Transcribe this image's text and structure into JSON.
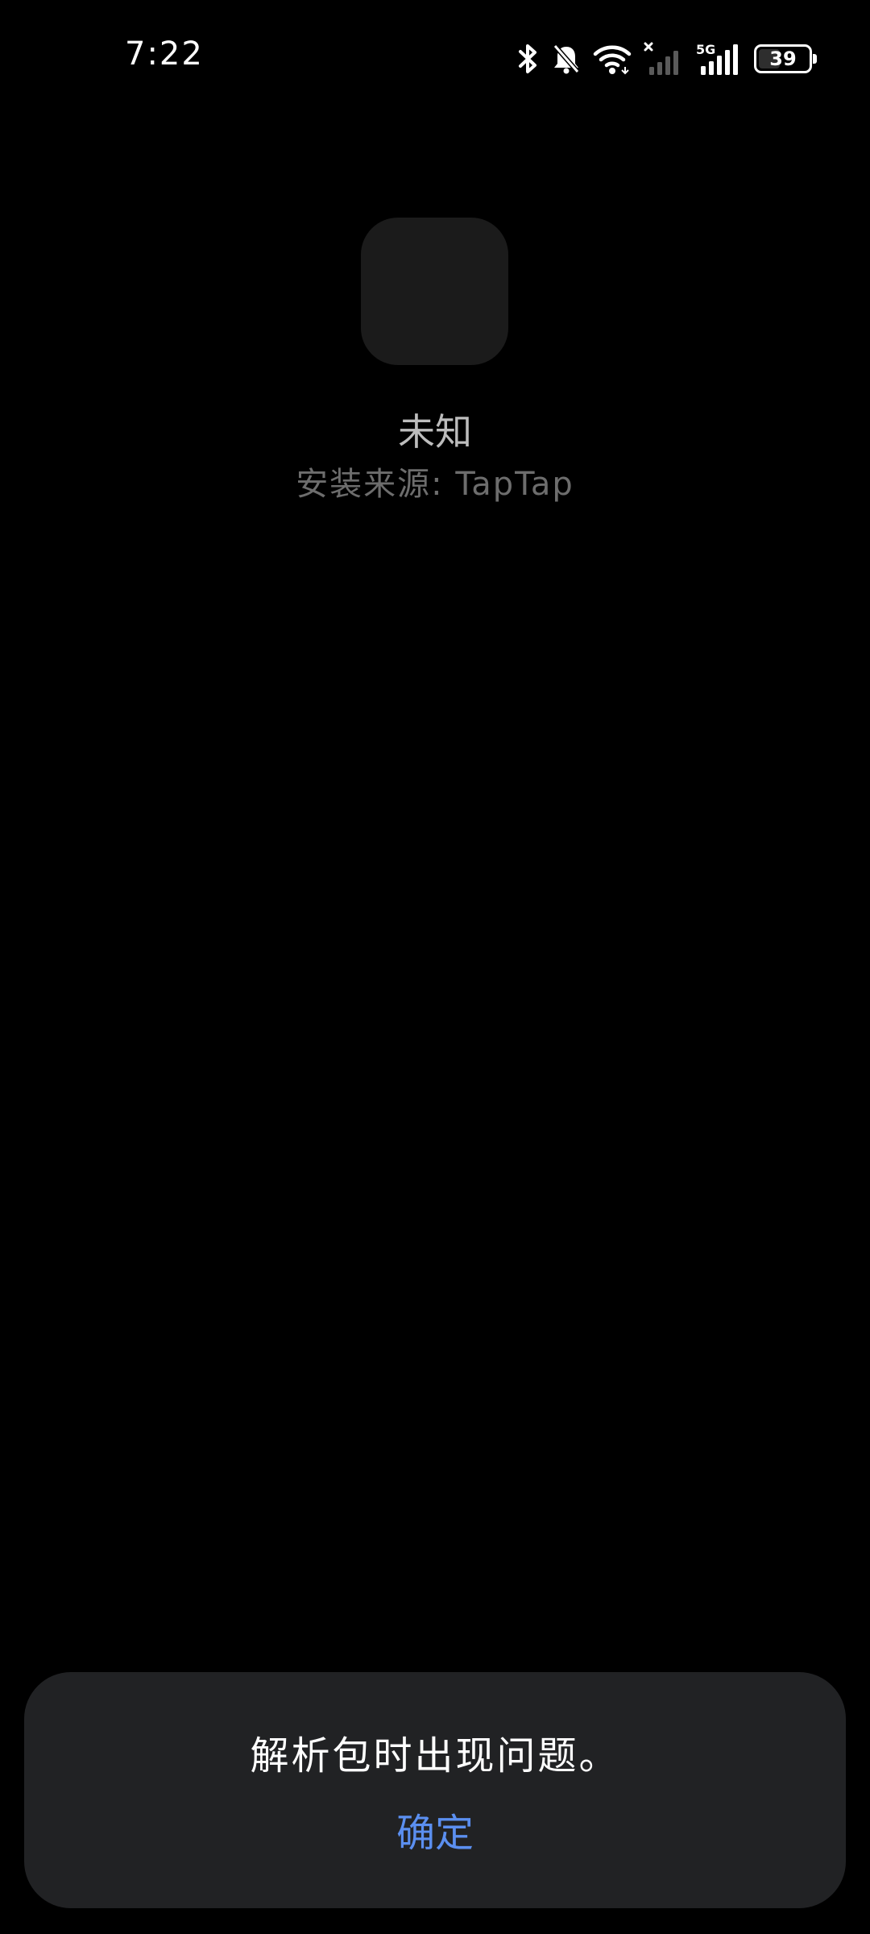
{
  "status_bar": {
    "time": "7:22",
    "battery_level": "39",
    "network": "5G",
    "icons": [
      "bluetooth-icon",
      "mute-bell-icon",
      "wifi-icon",
      "sim1-signal-icon",
      "sim2-signal-icon",
      "battery-icon"
    ]
  },
  "app": {
    "name": "未知",
    "install_source": "安装来源: TapTap"
  },
  "dialog": {
    "message": "解析包时出现问题。",
    "confirm_label": "确定"
  },
  "colors": {
    "background": "#000000",
    "dialog_background": "#212224",
    "accent": "#5b8ff0"
  }
}
